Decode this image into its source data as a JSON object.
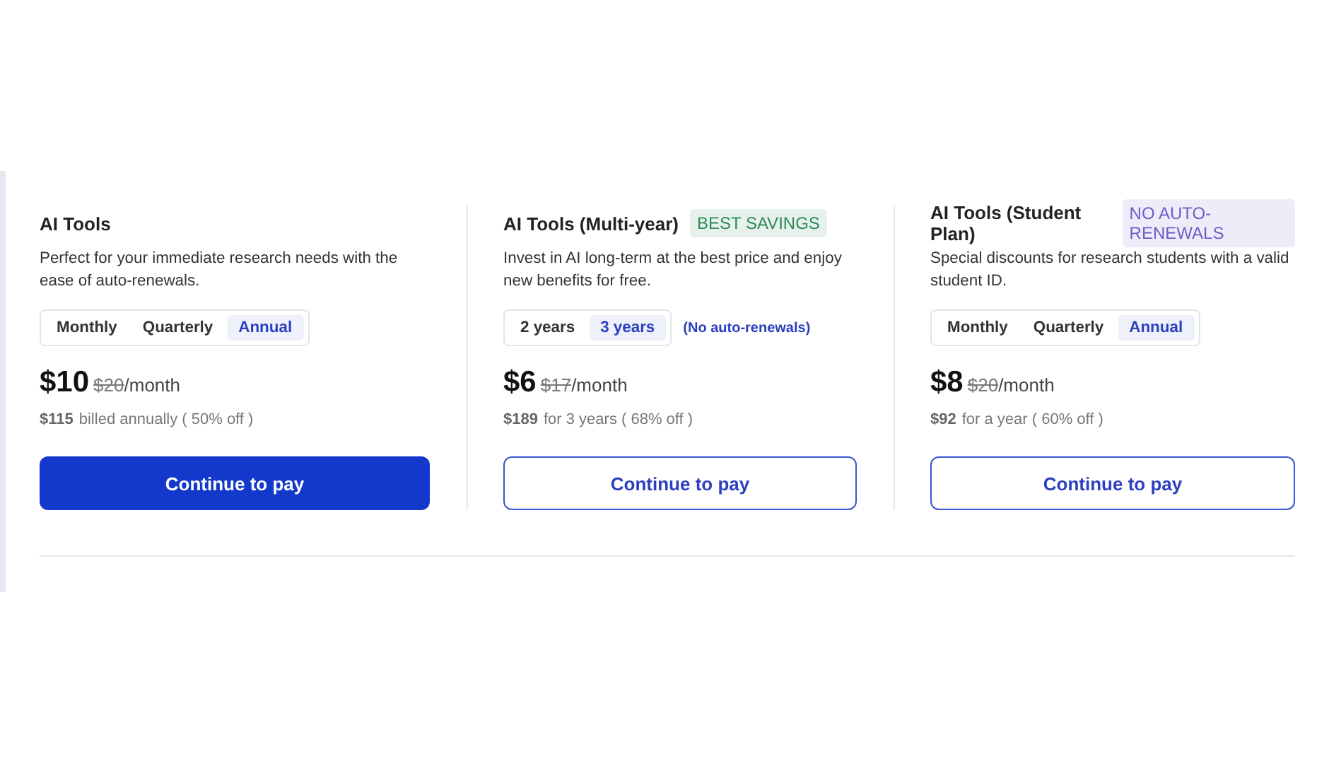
{
  "plans": [
    {
      "title": "AI Tools",
      "description": "Perfect for your immediate research needs with the ease of auto-renewals.",
      "options": [
        {
          "label": "Monthly",
          "selected": false
        },
        {
          "label": "Quarterly",
          "selected": false
        },
        {
          "label": "Annual",
          "selected": true
        }
      ],
      "price": "$10",
      "old_price": "$20",
      "unit": "/month",
      "billed_amount": "$115",
      "billed_text": "billed annually ( 50% off )",
      "button": {
        "label": "Continue to pay",
        "primary": true
      }
    },
    {
      "title": "AI Tools (Multi-year)",
      "badge": {
        "text": "BEST SAVINGS",
        "color": "#2e8b57"
      },
      "description": "Invest in AI long-term at the best price and enjoy new benefits for free.",
      "options": [
        {
          "label": "2 years",
          "selected": false
        },
        {
          "label": "3 years",
          "selected": true
        }
      ],
      "note": "(No auto-renewals)",
      "price": "$6",
      "old_price": "$17",
      "unit": "/month",
      "billed_amount": "$189",
      "billed_text": "for 3 years ( 68% off )",
      "button": {
        "label": "Continue to pay",
        "primary": false
      }
    },
    {
      "title": "AI Tools (Student Plan)",
      "badge": {
        "text": "NO AUTO-RENEWALS",
        "color": "#6a5fc8"
      },
      "description": "Special discounts for research students with a valid student ID.",
      "options": [
        {
          "label": "Monthly",
          "selected": false
        },
        {
          "label": "Quarterly",
          "selected": false
        },
        {
          "label": "Annual",
          "selected": true
        }
      ],
      "price": "$8",
      "old_price": "$20",
      "unit": "/month",
      "billed_amount": "$92",
      "billed_text": "for a year ( 60% off )",
      "button": {
        "label": "Continue to pay",
        "primary": false
      }
    }
  ]
}
